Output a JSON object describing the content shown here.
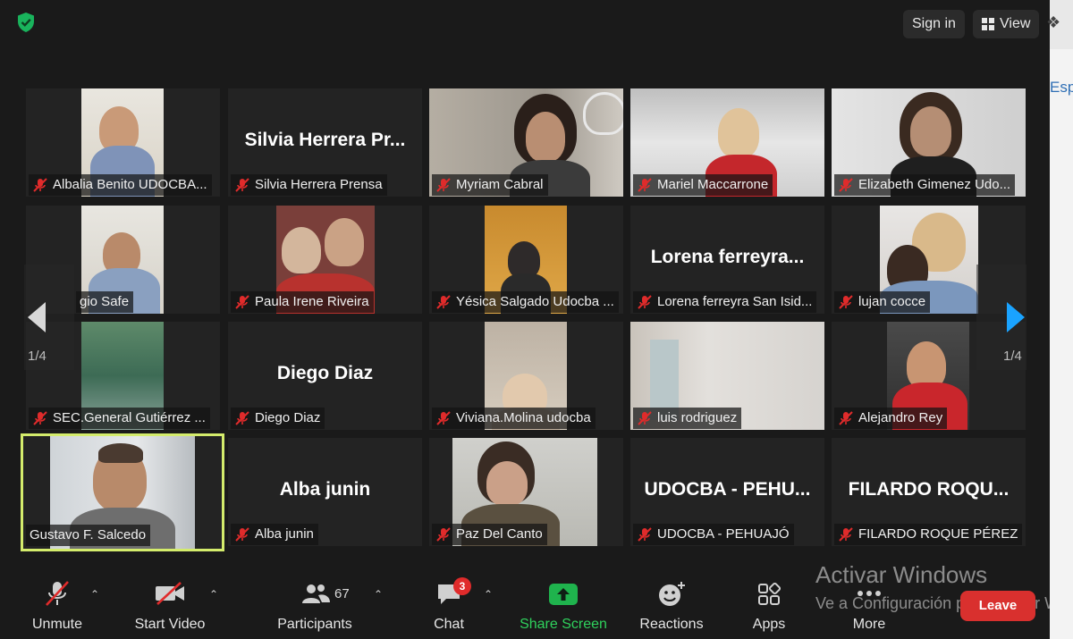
{
  "header": {
    "sign_in": "Sign in",
    "view": "View"
  },
  "nav": {
    "page_left": "1/4",
    "page_right": "1/4"
  },
  "edge_text": "Esp",
  "tiles": [
    {
      "name": "Albalia Benito UDOCBA...",
      "big": "",
      "muted": true
    },
    {
      "name": "Silvia Herrera Prensa",
      "big": "Silvia  Herrera  Pr...",
      "muted": true
    },
    {
      "name": "Myriam Cabral",
      "big": "",
      "muted": true
    },
    {
      "name": "Mariel Maccarrone",
      "big": "",
      "muted": true
    },
    {
      "name": "Elizabeth Gimenez Udo...",
      "big": "",
      "muted": true
    },
    {
      "name": "gio Safe",
      "big": "",
      "muted": false
    },
    {
      "name": "Paula Irene Riveira",
      "big": "",
      "muted": true
    },
    {
      "name": "Yésica Salgado Udocba ...",
      "big": "",
      "muted": true
    },
    {
      "name": "Lorena ferreyra San Isid...",
      "big": "Lorena  ferreyra...",
      "muted": true
    },
    {
      "name": "lujan cocce",
      "big": "",
      "muted": true
    },
    {
      "name": "SEC.General Gutiérrez ...",
      "big": "",
      "muted": true
    },
    {
      "name": "Diego Diaz",
      "big": "Diego Diaz",
      "muted": true
    },
    {
      "name": "Viviana.Molina udocba",
      "big": "",
      "muted": true
    },
    {
      "name": "luis rodriguez",
      "big": "",
      "muted": true
    },
    {
      "name": "Alejandro Rey",
      "big": "",
      "muted": true
    },
    {
      "name": "Gustavo F. Salcedo",
      "big": "",
      "muted": false
    },
    {
      "name": "Alba junin",
      "big": "Alba junin",
      "muted": true
    },
    {
      "name": "Paz Del Canto",
      "big": "",
      "muted": true
    },
    {
      "name": "UDOCBA - PEHUAJÓ",
      "big": "UDOCBA  -  PEHU...",
      "muted": true
    },
    {
      "name": "FILARDO ROQUE PÉREZ",
      "big": "FILARDO  ROQU...",
      "muted": true
    }
  ],
  "toolbar": {
    "unmute": "Unmute",
    "start_video": "Start Video",
    "participants": "Participants",
    "participants_count": "67",
    "chat": "Chat",
    "chat_badge": "3",
    "share_screen": "Share Screen",
    "reactions": "Reactions",
    "apps": "Apps",
    "more": "More",
    "leave": "Leave"
  },
  "watermark": {
    "line1": "Activar Windows",
    "line2": "Ve a Configuración para activar W"
  },
  "colors": {
    "background": "#1a1a1a",
    "tile": "#232323",
    "active_speaker": "#d4ec6c",
    "share": "#2fd15c",
    "leave": "#d9302e",
    "mute": "#e02b2b"
  }
}
